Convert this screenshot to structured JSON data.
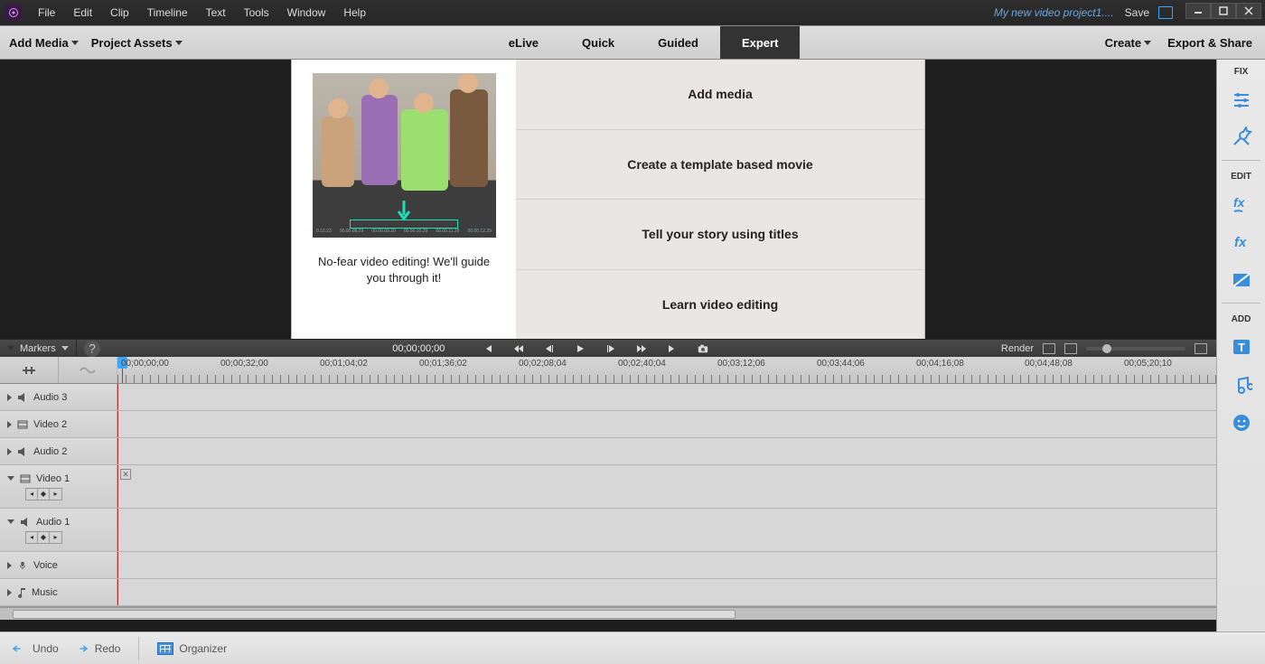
{
  "titlebar": {
    "menus": [
      "File",
      "Edit",
      "Clip",
      "Timeline",
      "Text",
      "Tools",
      "Window",
      "Help"
    ],
    "project_name": "My new video project1....",
    "save": "Save"
  },
  "toolbar": {
    "add_media": "Add Media",
    "project_assets": "Project Assets",
    "modes": {
      "elive": "eLive",
      "quick": "Quick",
      "guided": "Guided",
      "expert": "Expert"
    },
    "create": "Create",
    "export": "Export & Share"
  },
  "welcome": {
    "caption": "No-fear video editing! We'll guide you through it!",
    "options": [
      "Add media",
      "Create a template based movie",
      "Tell your story using titles",
      "Learn video editing"
    ]
  },
  "playbar": {
    "markers": "Markers",
    "timecode": "00;00;00;00",
    "render": "Render"
  },
  "ruler": {
    "labels": [
      "00;00;00;00",
      "00;00;32;00",
      "00;01;04;02",
      "00;01;36;02",
      "00;02;08;04",
      "00;02;40;04",
      "00;03;12;06",
      "00;03;44;06",
      "00;04;16;08",
      "00;04;48;08",
      "00;05;20;10"
    ]
  },
  "tracks": {
    "audio3": "Audio 3",
    "video2": "Video 2",
    "audio2": "Audio 2",
    "video1": "Video 1",
    "audio1": "Audio 1",
    "voice": "Voice",
    "music": "Music"
  },
  "bottom": {
    "undo": "Undo",
    "redo": "Redo",
    "organizer": "Organizer"
  },
  "rail": {
    "fix": "FIX",
    "edit": "EDIT",
    "add": "ADD"
  }
}
